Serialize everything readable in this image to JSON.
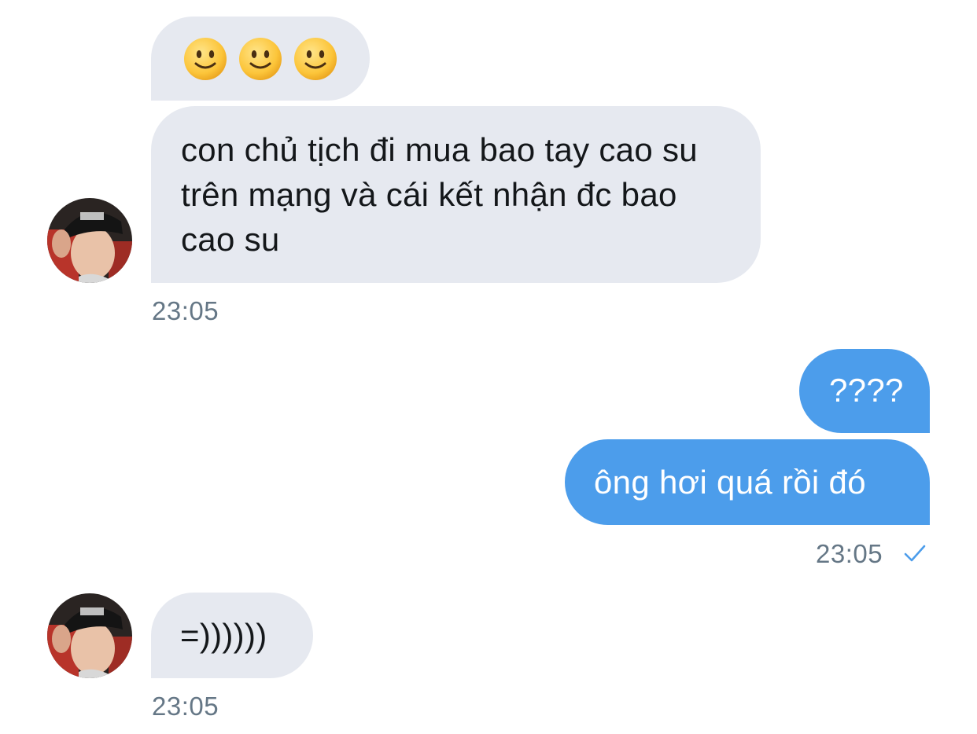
{
  "conversation": {
    "messages": [
      {
        "side": "incoming",
        "text": "",
        "emoji": [
          "slightly-smiling-face",
          "slightly-smiling-face",
          "slightly-smiling-face"
        ]
      },
      {
        "side": "incoming",
        "text": "con chủ tịch đi mua bao tay cao su trên mạng và cái kết nhận đc bao cao su"
      },
      {
        "side": "outgoing",
        "text": "????"
      },
      {
        "side": "outgoing",
        "text": "ông hơi quá rồi đó"
      },
      {
        "side": "incoming",
        "text": "=))))))"
      }
    ],
    "timestamps": [
      "23:05",
      "23:05",
      "23:05"
    ],
    "read_receipt": "check-icon"
  },
  "colors": {
    "incoming_bubble": "#e6e9f0",
    "outgoing_bubble": "#4c9deb",
    "timestamp": "#657786",
    "check": "#4c9deb"
  }
}
